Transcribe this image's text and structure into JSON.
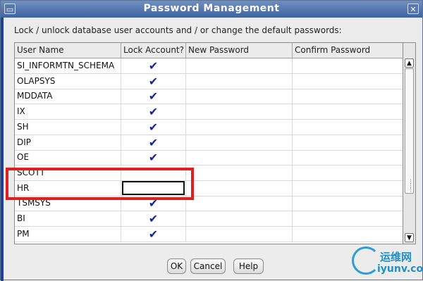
{
  "window": {
    "title": "Password Management",
    "left_button_icon": "window-menu-icon",
    "close_icon": "close-icon"
  },
  "description": "Lock / unlock database user accounts and / or change the default passwords:",
  "table": {
    "columns": [
      "User Name",
      "Lock Account?",
      "New Password",
      "Confirm Password"
    ],
    "rows": [
      {
        "user": "SI_INFORMTN_SCHEMA",
        "locked": "✔",
        "new_password": "",
        "confirm_password": ""
      },
      {
        "user": "OLAPSYS",
        "locked": "✔",
        "new_password": "",
        "confirm_password": ""
      },
      {
        "user": "MDDATA",
        "locked": "✔",
        "new_password": "",
        "confirm_password": ""
      },
      {
        "user": "IX",
        "locked": "✔",
        "new_password": "",
        "confirm_password": ""
      },
      {
        "user": "SH",
        "locked": "✔",
        "new_password": "",
        "confirm_password": ""
      },
      {
        "user": "DIP",
        "locked": "✔",
        "new_password": "",
        "confirm_password": ""
      },
      {
        "user": "OE",
        "locked": "✔",
        "new_password": "",
        "confirm_password": ""
      },
      {
        "user": "SCOTT",
        "locked": "",
        "new_password": "",
        "confirm_password": ""
      },
      {
        "user": "HR",
        "locked": "",
        "new_password": "",
        "confirm_password": ""
      },
      {
        "user": "TSMSYS",
        "locked": "✔",
        "new_password": "",
        "confirm_password": ""
      },
      {
        "user": "BI",
        "locked": "✔",
        "new_password": "",
        "confirm_password": ""
      },
      {
        "user": "PM",
        "locked": "✔",
        "new_password": "",
        "confirm_password": ""
      }
    ],
    "highlight_color": "#e01f1f"
  },
  "buttons": {
    "ok": "OK",
    "cancel": "Cancel",
    "help": "Help"
  },
  "watermark": {
    "cn_text": "运维网",
    "en_text": "iyunv.com"
  }
}
